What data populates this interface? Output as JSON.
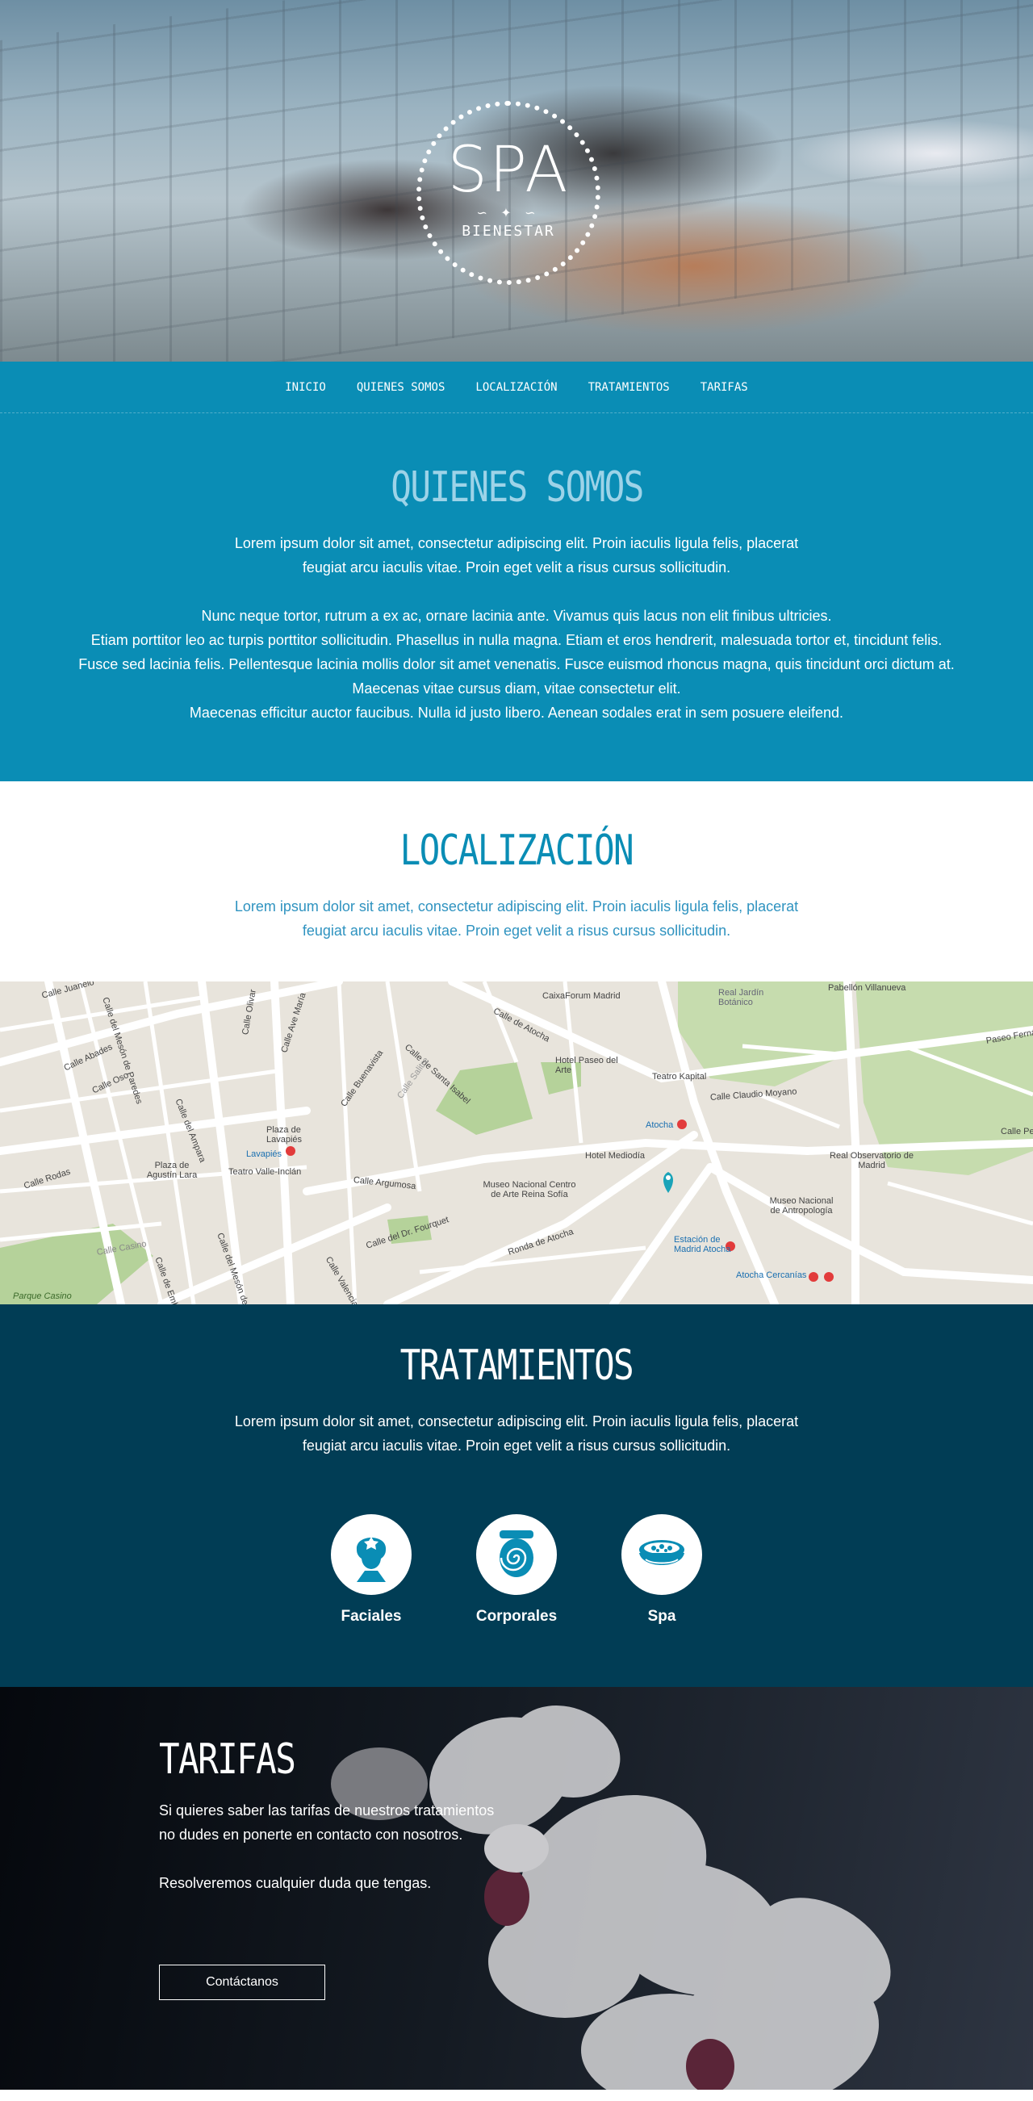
{
  "hero": {
    "logo_title": "SPA",
    "logo_subtitle": "BIENESTAR",
    "logo_ornament": "∽ ✦ ∽"
  },
  "nav": {
    "items": [
      "INICIO",
      "QUIENES SOMOS",
      "LOCALIZACIÓN",
      "TRATAMIENTOS",
      "TARIFAS"
    ]
  },
  "quienes": {
    "title": "QUIENES SOMOS",
    "paragraph1_line1": "Lorem ipsum dolor sit amet, consectetur adipiscing elit. Proin iaculis ligula felis, placerat",
    "paragraph1_line2": "feugiat arcu iaculis vitae. Proin eget velit a risus cursus sollicitudin.",
    "paragraph2_lines": [
      "Nunc neque tortor, rutrum a ex ac, ornare lacinia ante. Vivamus quis lacus non elit finibus ultricies.",
      "Etiam porttitor leo ac turpis porttitor sollicitudin. Phasellus in nulla magna. Etiam et eros hendrerit, malesuada tortor et, tincidunt felis.",
      "Fusce sed lacinia felis. Pellentesque lacinia mollis dolor sit amet venenatis. Fusce euismod rhoncus magna, quis tincidunt orci dictum at.",
      "Maecenas vitae cursus diam, vitae consectetur elit.",
      "Maecenas efficitur auctor faucibus. Nulla id justo libero. Aenean sodales erat in sem posuere eleifend."
    ]
  },
  "localizacion": {
    "title": "LOCALIZACIÓN",
    "line1": "Lorem ipsum dolor sit amet, consectetur adipiscing elit. Proin iaculis ligula felis, placerat",
    "line2": "feugiat arcu iaculis vitae. Proin eget velit a risus cursus sollicitudin."
  },
  "map": {
    "labels": [
      "Calle Juanelo",
      "Calle del Mesón de Paredes",
      "Calle Abades",
      "Calle Oso",
      "Calle Olivar",
      "Calle Ave María",
      "Calle de Atocha",
      "CaixaForum Madrid",
      "Real Jardín Botánico",
      "Pabellón Villanueva",
      "Paseo Fernán",
      "Calle Buenavista",
      "Calle de Santa Isabel",
      "Calle Salitre",
      "Hotel Paseo del Arte",
      "Teatro Kapital",
      "Calle Claudio Moyano",
      "Calle del Ampara",
      "Plaza de Lavapiés",
      "Lavapiés",
      "Atocha",
      "Hotel Mediodía",
      "Real Observatorio de Madrid",
      "Calle Peli",
      "Calle Rodas",
      "Plaza de Agustín Lara",
      "Teatro Valle-Inclán",
      "Calle Argumosa",
      "Museo Nacional Centro de Arte Reina Sofía",
      "Museo Nacional de Antropología",
      "Calle del Dr. Fourquet",
      "Ronda de Atocha",
      "Estación de Madrid Atocha",
      "Atocha Cercanías",
      "Calle Casino",
      "Calle de Embajadores",
      "Calle del Mesón de Paredes",
      "Calle Valencia",
      "Parque Casino"
    ]
  },
  "tratamientos": {
    "title": "TRATAMIENTOS",
    "line1": "Lorem ipsum dolor sit amet, consectetur adipiscing elit. Proin iaculis ligula felis, placerat",
    "line2": "feugiat arcu iaculis vitae. Proin eget velit a risus cursus sollicitudin.",
    "items": [
      {
        "label": "Faciales",
        "icon": "face-towel-icon"
      },
      {
        "label": "Corporales",
        "icon": "rolled-towel-icon"
      },
      {
        "label": "Spa",
        "icon": "spa-bowl-icon"
      }
    ]
  },
  "tarifas": {
    "title": "TARIFAS",
    "line1": "Si quieres saber las tarifas de nuestros tratamientos",
    "line2": "no dudes en ponerte en contacto con nosotros.",
    "line3": "Resolveremos cualquier duda que tengas.",
    "button_label": "Contáctanos"
  },
  "colors": {
    "primary": "#0a8db5",
    "dark": "#013d55",
    "light_title": "#9dd3e8",
    "map_bg": "#e8e4dc",
    "park": "#b5d29a"
  }
}
